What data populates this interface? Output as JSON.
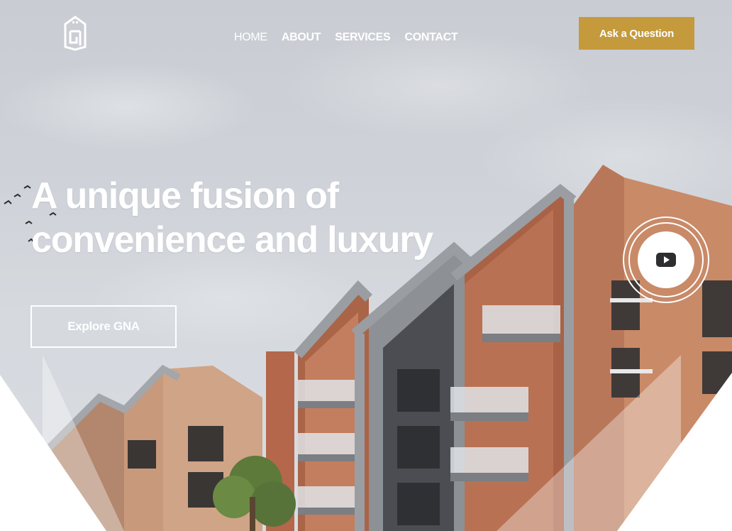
{
  "nav": {
    "items": [
      {
        "label": "HOME"
      },
      {
        "label": "ABOUT"
      },
      {
        "label": "SERVICES"
      },
      {
        "label": "CONTACT"
      }
    ],
    "cta_label": "Ask a Question"
  },
  "hero": {
    "headline_line1": "A unique fusion of",
    "headline_line2": "convenience and luxury",
    "explore_label": "Explore GNA"
  },
  "icons": {
    "logo": "gna-logo-icon",
    "video": "youtube-play-icon"
  },
  "colors": {
    "accent": "#c49a3c",
    "text": "#ffffff",
    "sky": "#cfd3d9",
    "brick": "#b56c4a",
    "facade_grey": "#8e9196"
  }
}
